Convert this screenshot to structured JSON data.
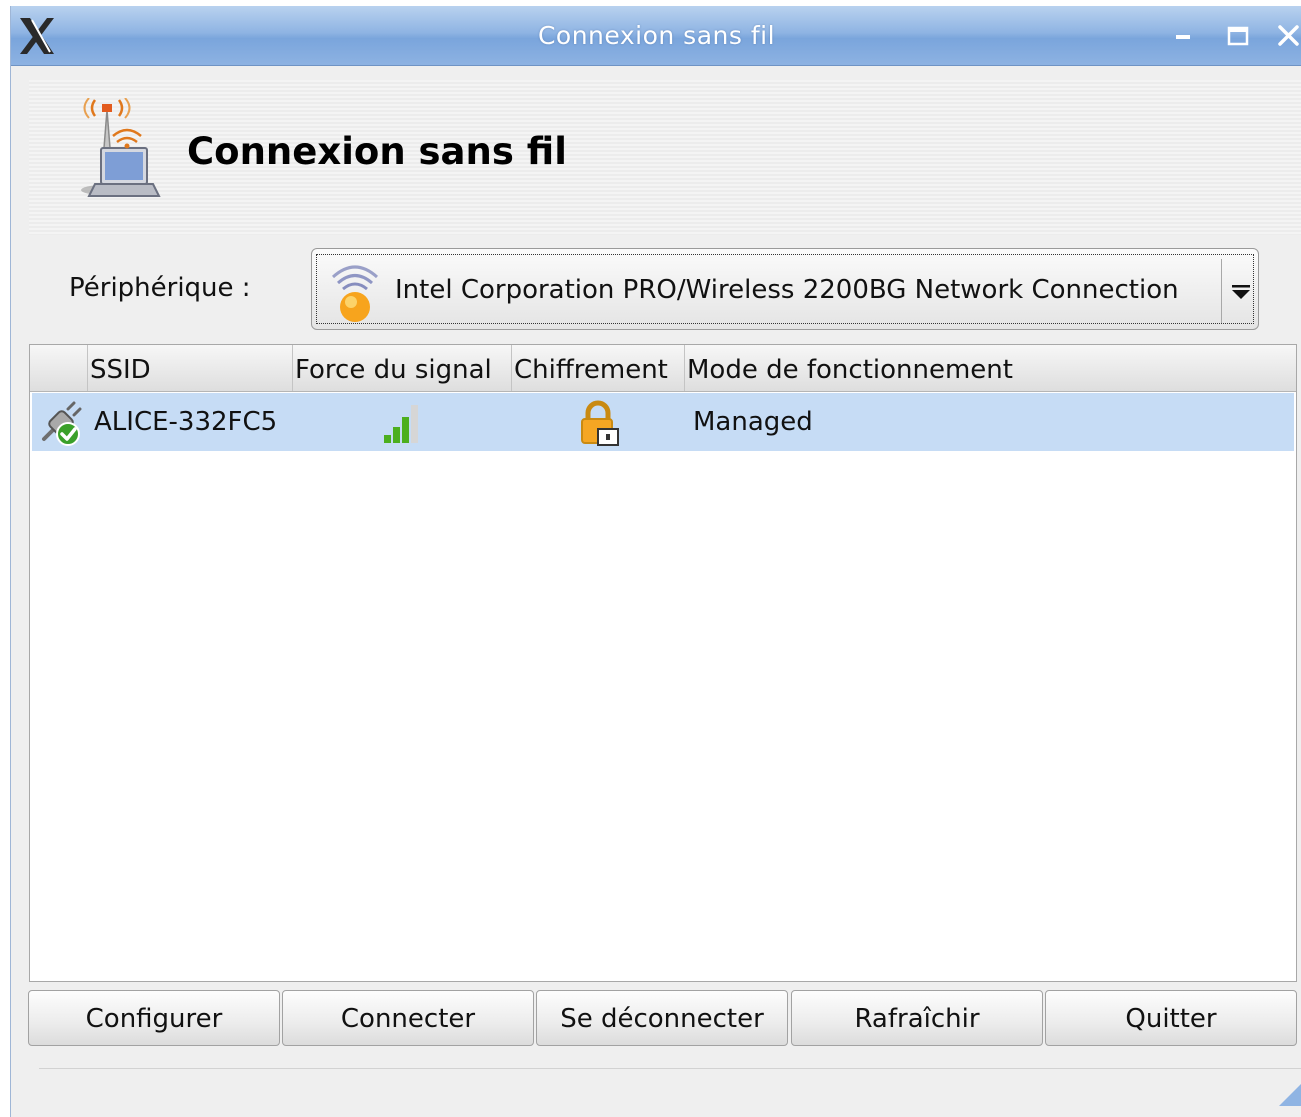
{
  "window": {
    "title": "Connexion sans fil"
  },
  "header": {
    "title": "Connexion sans fil"
  },
  "device": {
    "label": "Périphérique :",
    "selected": "Intel Corporation PRO/Wireless 2200BG Network Connection"
  },
  "table": {
    "columns": [
      "SSID",
      "Force du signal",
      "Chiffrement",
      "Mode de fonctionnement"
    ],
    "rows": [
      {
        "ssid": "ALICE-332FC5",
        "signal_level": 0.75,
        "encrypted": true,
        "mode": "Managed",
        "connected": true
      }
    ]
  },
  "buttons": {
    "configure": "Configurer",
    "connect": "Connecter",
    "disconnect": "Se déconnecter",
    "refresh": "Rafraîchir",
    "quit": "Quitter"
  },
  "icons": {
    "app": "x-logo-icon",
    "header": "wireless-laptop-icon",
    "device": "wifi-device-icon",
    "status": "connected-plug-icon",
    "signal": "signal-strength-icon",
    "encryption": "padlock-icon"
  },
  "colors": {
    "titlebar": "#8fb4e3",
    "selection": "#c6dcf5",
    "signal": "#4caf1f",
    "lock": "#f5a623"
  }
}
